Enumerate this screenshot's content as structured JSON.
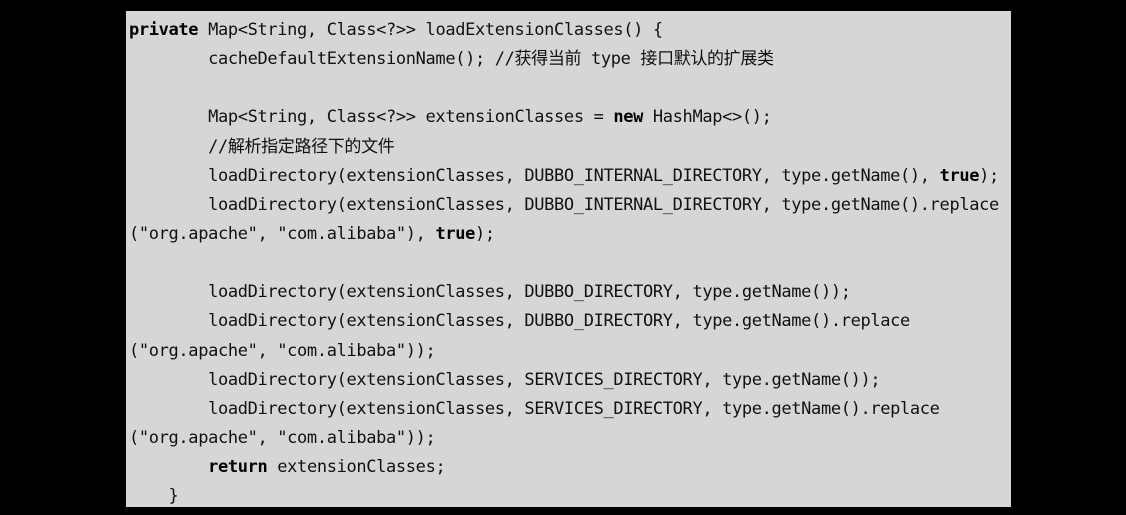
{
  "code": {
    "language": "java",
    "lines": [
      [
        {
          "t": "private",
          "k": "kw"
        },
        {
          "t": " Map<String, Class<?>> loadExtensionClasses() {"
        }
      ],
      [
        {
          "t": "        cacheDefaultExtensionName(); "
        },
        {
          "t": "//获得当前 type 接口默认的扩展类",
          "k": "cm"
        }
      ],
      [],
      [
        {
          "t": "        Map<String, Class<?>> extensionClasses = "
        },
        {
          "t": "new",
          "k": "kw"
        },
        {
          "t": " HashMap<>();"
        }
      ],
      [
        {
          "t": "        "
        },
        {
          "t": "//解析指定路径下的文件",
          "k": "cm"
        }
      ],
      [
        {
          "t": "        loadDirectory(extensionClasses, DUBBO_INTERNAL_DIRECTORY, type.getName(), "
        },
        {
          "t": "true",
          "k": "kw"
        },
        {
          "t": ");"
        }
      ],
      [
        {
          "t": "        loadDirectory(extensionClasses, DUBBO_INTERNAL_DIRECTORY, type.getName().replace"
        }
      ],
      [
        {
          "t": "(\"org.apache\", \"com.alibaba\"), "
        },
        {
          "t": "true",
          "k": "kw"
        },
        {
          "t": ");"
        }
      ],
      [],
      [
        {
          "t": "        loadDirectory(extensionClasses, DUBBO_DIRECTORY, type.getName());"
        }
      ],
      [
        {
          "t": "        loadDirectory(extensionClasses, DUBBO_DIRECTORY, type.getName().replace"
        }
      ],
      [
        {
          "t": "(\"org.apache\", \"com.alibaba\"));"
        }
      ],
      [
        {
          "t": "        loadDirectory(extensionClasses, SERVICES_DIRECTORY, type.getName());"
        }
      ],
      [
        {
          "t": "        loadDirectory(extensionClasses, SERVICES_DIRECTORY, type.getName().replace"
        }
      ],
      [
        {
          "t": "(\"org.apache\", \"com.alibaba\"));"
        }
      ],
      [
        {
          "t": "        "
        },
        {
          "t": "return",
          "k": "kw"
        },
        {
          "t": " extensionClasses;"
        }
      ],
      [
        {
          "t": "    }"
        }
      ]
    ]
  }
}
